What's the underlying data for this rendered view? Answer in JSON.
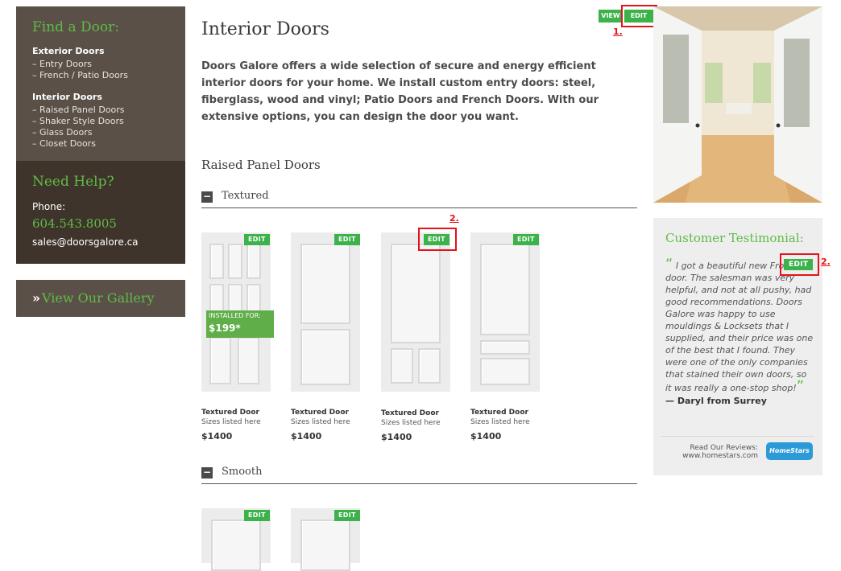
{
  "sidebar": {
    "find_heading": "Find a Door:",
    "groups": [
      {
        "title": "Exterior Doors",
        "links": [
          "– Entry Doors",
          "– French / Patio Doors"
        ]
      },
      {
        "title": "Interior Doors",
        "links": [
          "– Raised Panel Doors",
          "– Shaker Style Doors",
          "– Glass Doors",
          "– Closet Doors"
        ]
      }
    ],
    "help_heading": "Need Help?",
    "phone_label": "Phone:",
    "phone": "604.543.8005",
    "email": "sales@doorsgalore.ca",
    "gallery_prefix": "»",
    "gallery_label": "View Our Gallery"
  },
  "main": {
    "title": "Interior Doors",
    "view_label": "VIEW",
    "edit_label": "EDIT",
    "intro": "Doors Galore offers a wide selection of secure and energy efficient interior doors for your home. We install custom entry doors: steel, fiberglass, wood and vinyl; Patio Doors and French Doors. With our extensive options, you can design the door you want.",
    "section_title": "Raised Panel Doors",
    "toggle_symbol": "−",
    "textured_label": "Textured",
    "smooth_label": "Smooth",
    "installed_label": "INSTALLED FOR:",
    "installed_price": "$199*",
    "products": [
      {
        "name": "Textured Door",
        "sizes": "Sizes listed here",
        "price": "$1400"
      },
      {
        "name": "Textured Door",
        "sizes": "Sizes listed here",
        "price": "$1400"
      },
      {
        "name": "Textured Door",
        "sizes": "Sizes listed here",
        "price": "$1400"
      },
      {
        "name": "Textured Door",
        "sizes": "Sizes listed here",
        "price": "$1400"
      }
    ]
  },
  "annotations": {
    "one": "1.",
    "two": "2."
  },
  "testimonial": {
    "heading": "Customer Testimonial:",
    "open_quote": "“",
    "close_quote": "”",
    "quote": "I got a beautiful new Front door. The salesman was very helpful, and not at all pushy, had good recommendations. Doors Galore was happy to use mouldings & Locksets that I supplied, and their price was one of the best that I found. They were one of the only companies that stained their own doors, so it was really a one-stop shop!",
    "author": "— Daryl from Surrey",
    "reviews_line1": "Read Our Reviews:",
    "reviews_line2": "www.homestars.com",
    "homestars_label": "HomeStars"
  },
  "colors": {
    "accent_green": "#5fbb46",
    "sidebar_brown": "#5a5048",
    "edit_green": "#3db24b",
    "annotation_red": "#e3131b"
  }
}
